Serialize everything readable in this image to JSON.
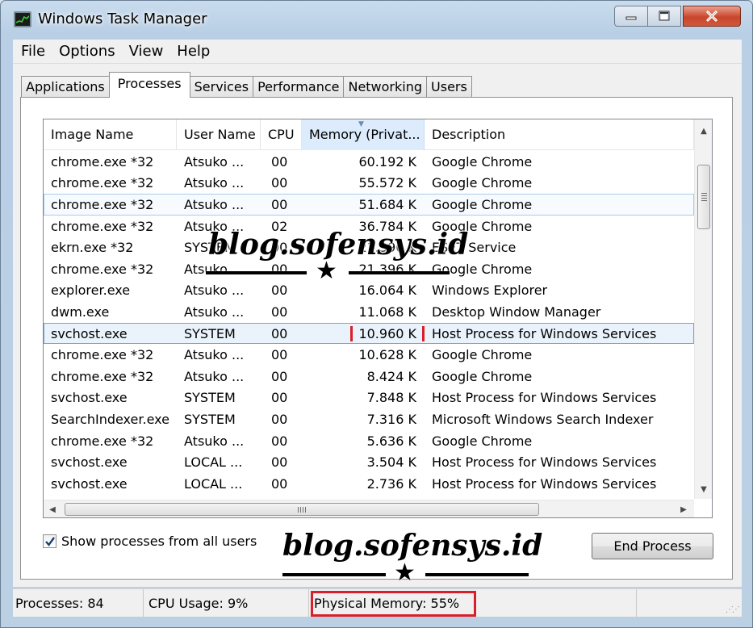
{
  "window": {
    "title": "Windows Task Manager"
  },
  "menu": [
    "File",
    "Options",
    "View",
    "Help"
  ],
  "tabs": [
    "Applications",
    "Processes",
    "Services",
    "Performance",
    "Networking",
    "Users"
  ],
  "active_tab": "Processes",
  "columns": [
    "Image Name",
    "User Name",
    "CPU",
    "Memory (Privat...",
    "Description"
  ],
  "rows": [
    [
      "chrome.exe *32",
      "Atsuko ...",
      "00",
      "60.192 K",
      "Google Chrome"
    ],
    [
      "chrome.exe *32",
      "Atsuko ...",
      "00",
      "55.572 K",
      "Google Chrome"
    ],
    [
      "chrome.exe *32",
      "Atsuko ...",
      "00",
      "51.684 K",
      "Google Chrome"
    ],
    [
      "chrome.exe *32",
      "Atsuko ...",
      "02",
      "36.784 K",
      "Google Chrome"
    ],
    [
      "ekrn.exe *32",
      "SYSTEM",
      "00",
      "21.396 K",
      "ESET Service"
    ],
    [
      "chrome.exe *32",
      "Atsuko ...",
      "00",
      "21.396 K",
      "Google Chrome"
    ],
    [
      "explorer.exe",
      "Atsuko ...",
      "00",
      "16.064 K",
      "Windows Explorer"
    ],
    [
      "dwm.exe",
      "Atsuko ...",
      "00",
      "11.068 K",
      "Desktop Window Manager"
    ],
    [
      "svchost.exe",
      "SYSTEM",
      "00",
      "10.960 K",
      "Host Process for Windows Services"
    ],
    [
      "chrome.exe *32",
      "Atsuko ...",
      "00",
      "10.628 K",
      "Google Chrome"
    ],
    [
      "chrome.exe *32",
      "Atsuko ...",
      "00",
      "8.424 K",
      "Google Chrome"
    ],
    [
      "svchost.exe",
      "SYSTEM",
      "00",
      "7.848 K",
      "Host Process for Windows Services"
    ],
    [
      "SearchIndexer.exe",
      "SYSTEM",
      "00",
      "7.316 K",
      "Microsoft Windows Search Indexer"
    ],
    [
      "chrome.exe *32",
      "Atsuko ...",
      "00",
      "5.636 K",
      "Google Chrome"
    ],
    [
      "svchost.exe",
      "LOCAL ...",
      "00",
      "3.504 K",
      "Host Process for Windows Services"
    ],
    [
      "svchost.exe",
      "LOCAL ...",
      "00",
      "2.736 K",
      "Host Process for Windows Services"
    ]
  ],
  "show_all_label": "Show processes from all users",
  "show_all_checked": true,
  "end_process_label": "End Process",
  "status": {
    "processes": "Processes: 84",
    "cpu": "CPU Usage: 9%",
    "memory": "Physical Memory: 55%"
  },
  "watermark": "blog.sofensys.id",
  "highlight_color": "#d9202a"
}
